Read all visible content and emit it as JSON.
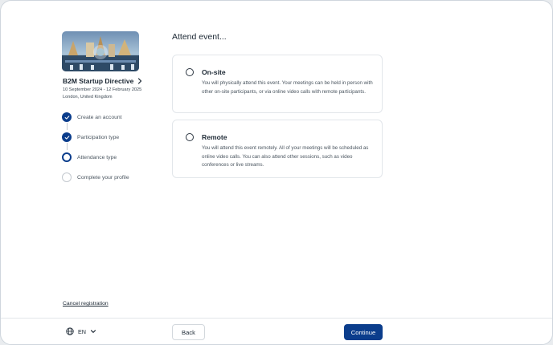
{
  "event": {
    "title": "B2M Startup Directive",
    "dates": "10 September 2024 - 12 February 2025",
    "location": "London, United Kingdom",
    "image_icon": "event-banner-image"
  },
  "steps": [
    {
      "label": "Create an account",
      "status": "done"
    },
    {
      "label": "Participation type",
      "status": "done"
    },
    {
      "label": "Attendance type",
      "status": "current"
    },
    {
      "label": "Complete your profile",
      "status": "todo"
    }
  ],
  "cancel_label": "Cancel registration",
  "main": {
    "title": "Attend event...",
    "options": [
      {
        "title": "On-site",
        "description": "You will physically attend this event. Your meetings can be held in person with other on-site participants, or via online video calls with remote participants.",
        "selected": false
      },
      {
        "title": "Remote",
        "description": "You will attend this event remotely. All of your meetings will be scheduled as online video calls. You can also attend other sessions, such as video conferences or live streams.",
        "selected": false
      }
    ]
  },
  "footer": {
    "language": "EN",
    "back_label": "Back",
    "continue_label": "Continue"
  },
  "colors": {
    "accent": "#0b3d8c",
    "border": "#e2e6ea",
    "text": "#1b2733",
    "muted": "#4b5660"
  }
}
